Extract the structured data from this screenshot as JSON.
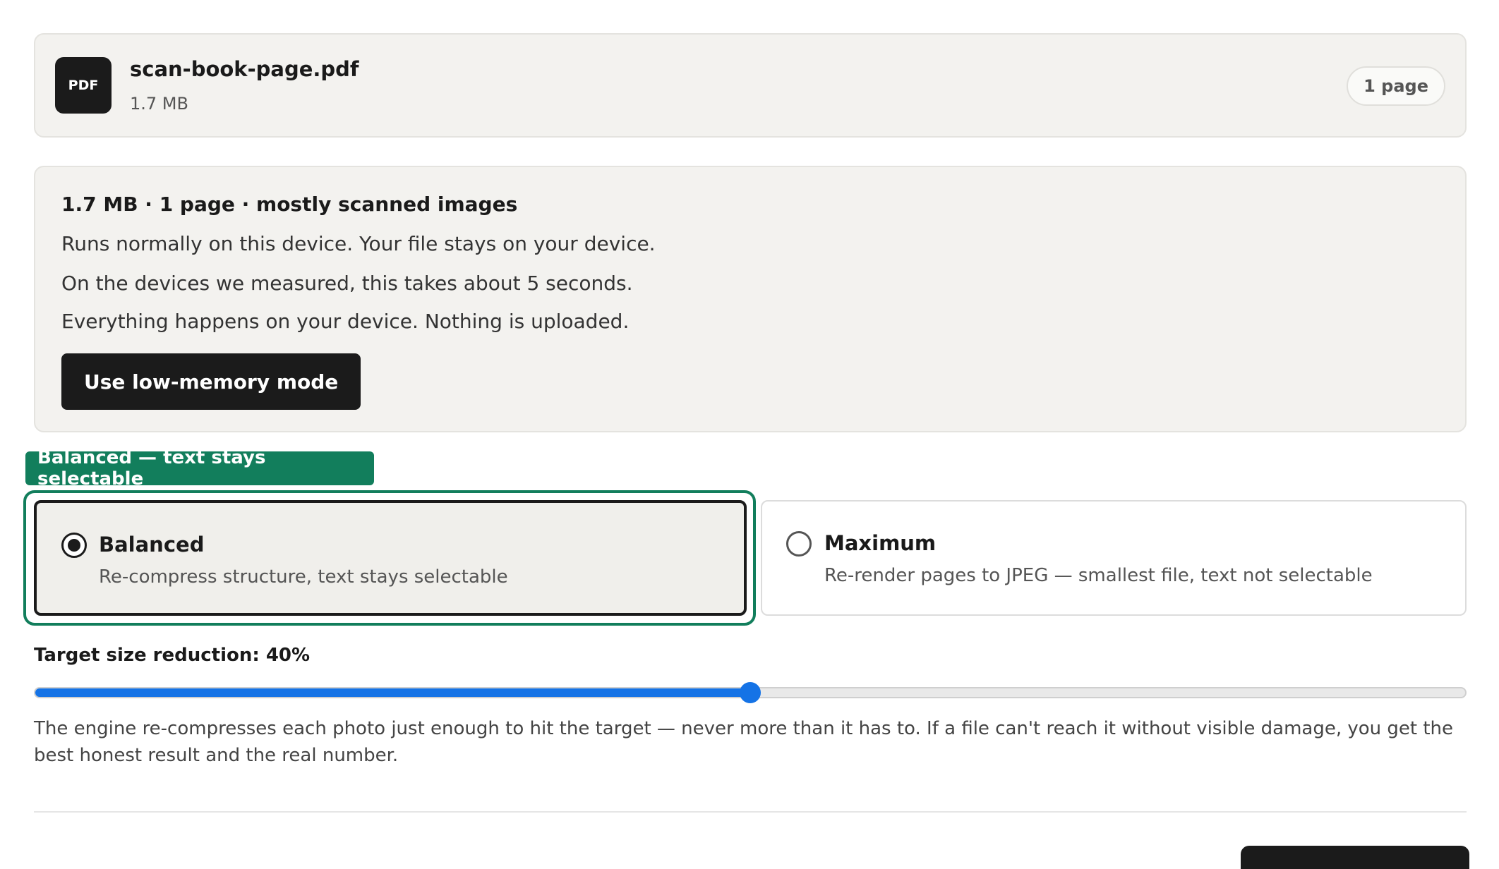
{
  "file": {
    "badge": "PDF",
    "name": "scan-book-page.pdf",
    "size": "1.7 MB",
    "pages": "1 page"
  },
  "info": {
    "title": "1.7 MB · 1 page · mostly scanned images",
    "line1": "Runs normally on this device. Your file stays on your device.",
    "line2": "On the devices we measured, this takes about 5 seconds.",
    "line3": "Everything happens on your device. Nothing is uploaded.",
    "low_memory_label": "Use low-memory mode"
  },
  "tooltip": "Balanced — text stays selectable",
  "options": [
    {
      "title": "Balanced",
      "description": "Re-compress structure, text stays selectable",
      "selected": true
    },
    {
      "title": "Maximum",
      "description": "Re-render pages to JPEG — smallest file, text not selectable",
      "selected": false
    }
  ],
  "slider": {
    "label": "Target size reduction: 40%",
    "value_percent": 50,
    "accent": "#1573e6"
  },
  "explain": "The engine re-compresses each photo just enough to hit the target — never more than it has to. If a file can't reach it without visible damage, you get the best honest result and the real number.",
  "colors": {
    "tooltip": "#127e5c",
    "dark": "#1b1b1b"
  }
}
